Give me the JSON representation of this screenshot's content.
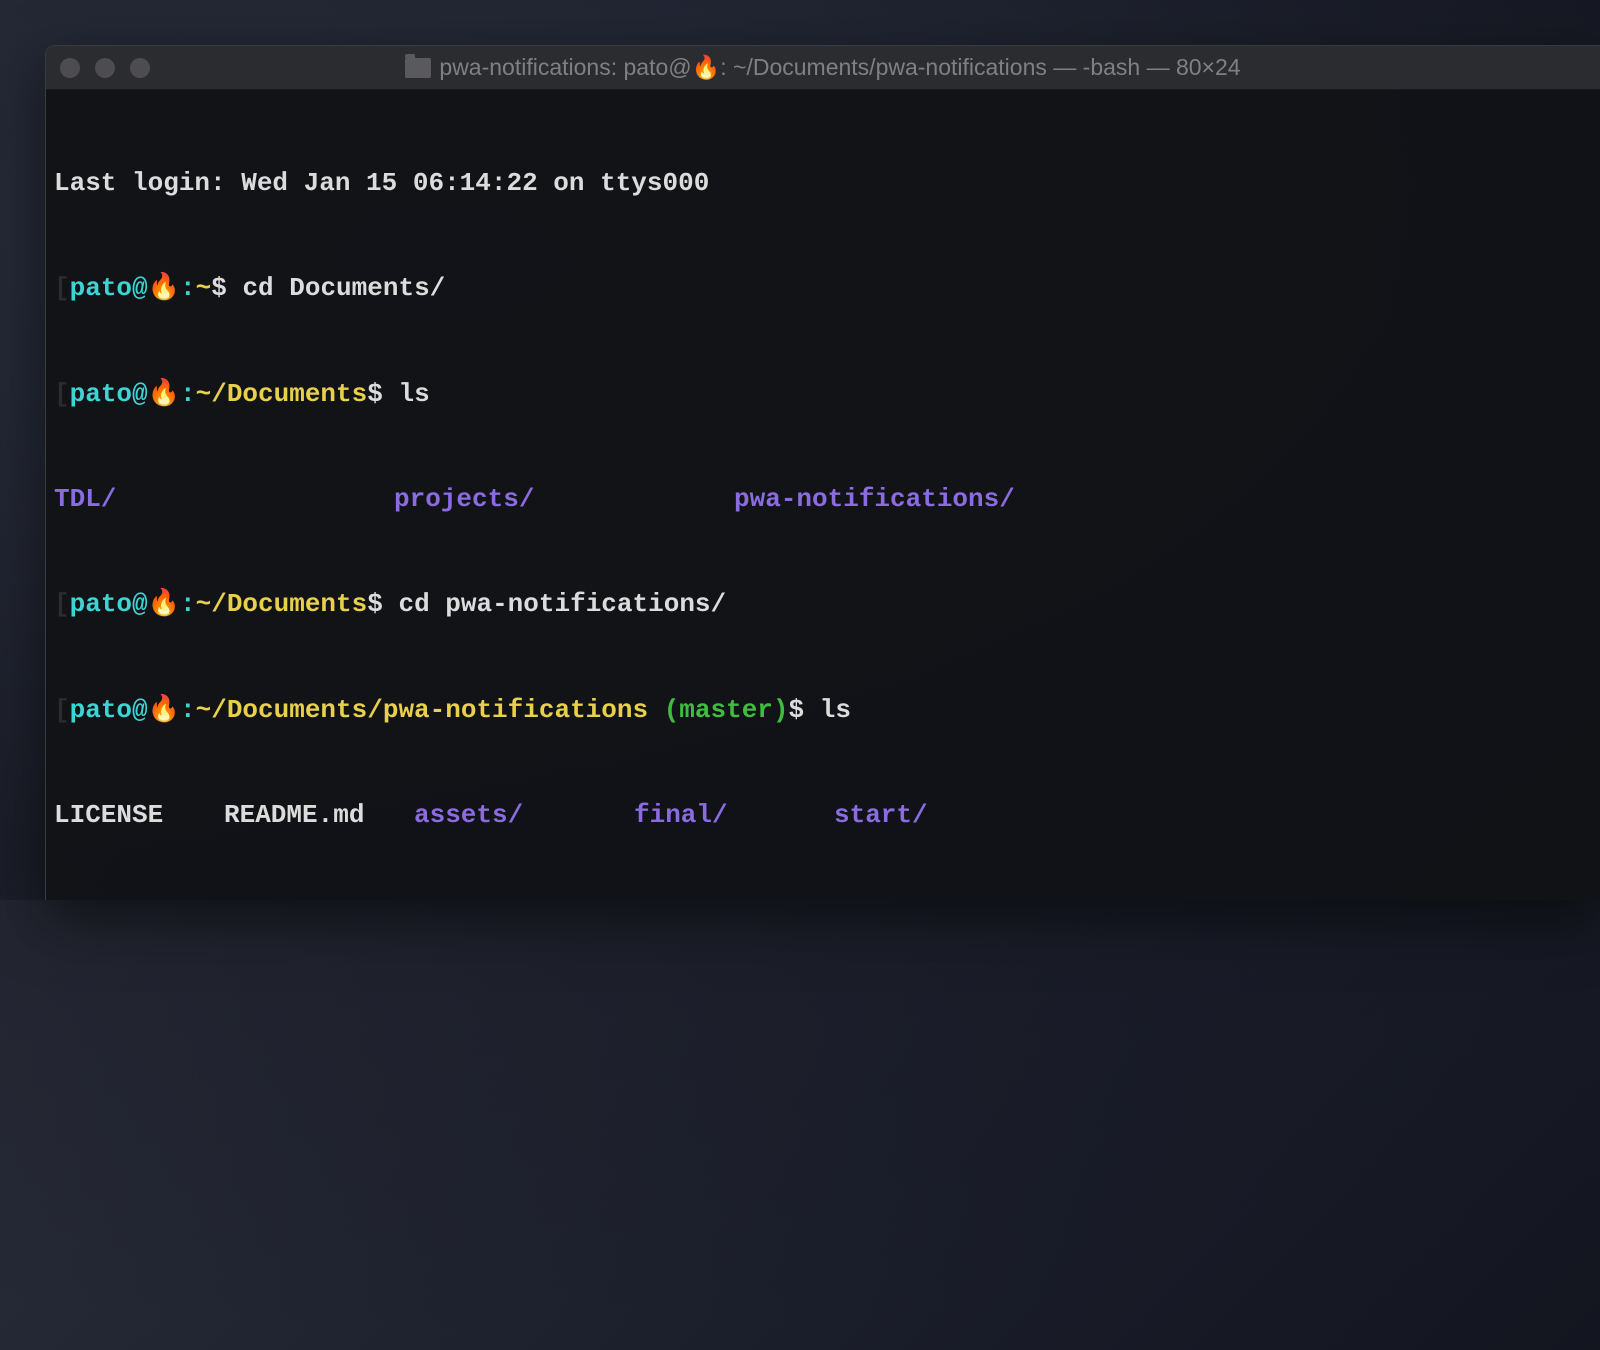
{
  "titlebar": {
    "title_prefix": "pwa-notifications: pato@",
    "emoji": "🔥",
    "title_suffix": ": ~/Documents/pwa-notifications — -bash — 80×24"
  },
  "lines": {
    "lastlogin": "Last login: Wed Jan 15 06:14:22 on ttys000",
    "bracket": "[",
    "user": "pato@",
    "emoji": "🔥",
    "sep": ":",
    "home": "~",
    "docs": "~/Documents",
    "pwapath": "~/Documents/pwa-notifications",
    "branch": " (master)",
    "dollar": "$ ",
    "cmd1": "cd Documents/",
    "cmd2": "ls",
    "cmd3": "cd pwa-notifications/",
    "cmd4": "ls"
  },
  "ls1": {
    "c1": "TDL/",
    "c2": "projects/",
    "c3": "pwa-notifications/"
  },
  "ls2": {
    "c1": "LICENSE",
    "c2": "README.md",
    "c3": "assets/",
    "c4": "final/",
    "c5": "start/"
  }
}
